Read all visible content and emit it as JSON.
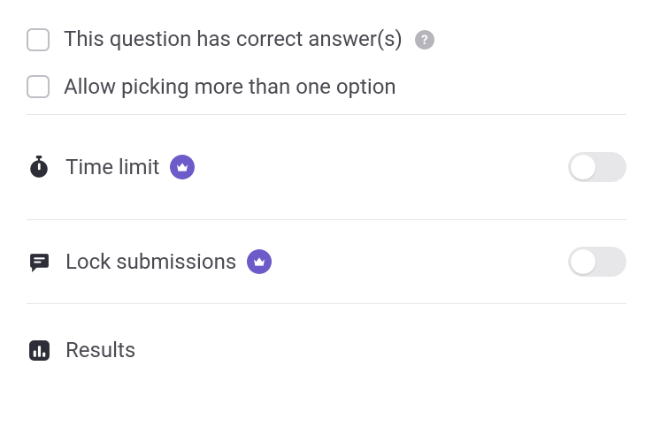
{
  "options": {
    "correctAnswers": {
      "label": "This question has correct answer(s)",
      "checked": false
    },
    "multiOption": {
      "label": "Allow picking more than one option",
      "checked": false
    }
  },
  "settings": {
    "timeLimit": {
      "label": "Time limit",
      "premium": true,
      "enabled": false
    },
    "lockSubmissions": {
      "label": "Lock submissions",
      "premium": true,
      "enabled": false
    },
    "results": {
      "label": "Results"
    }
  },
  "colors": {
    "accent": "#6c5bc9",
    "iconDark": "#2e2e38"
  }
}
